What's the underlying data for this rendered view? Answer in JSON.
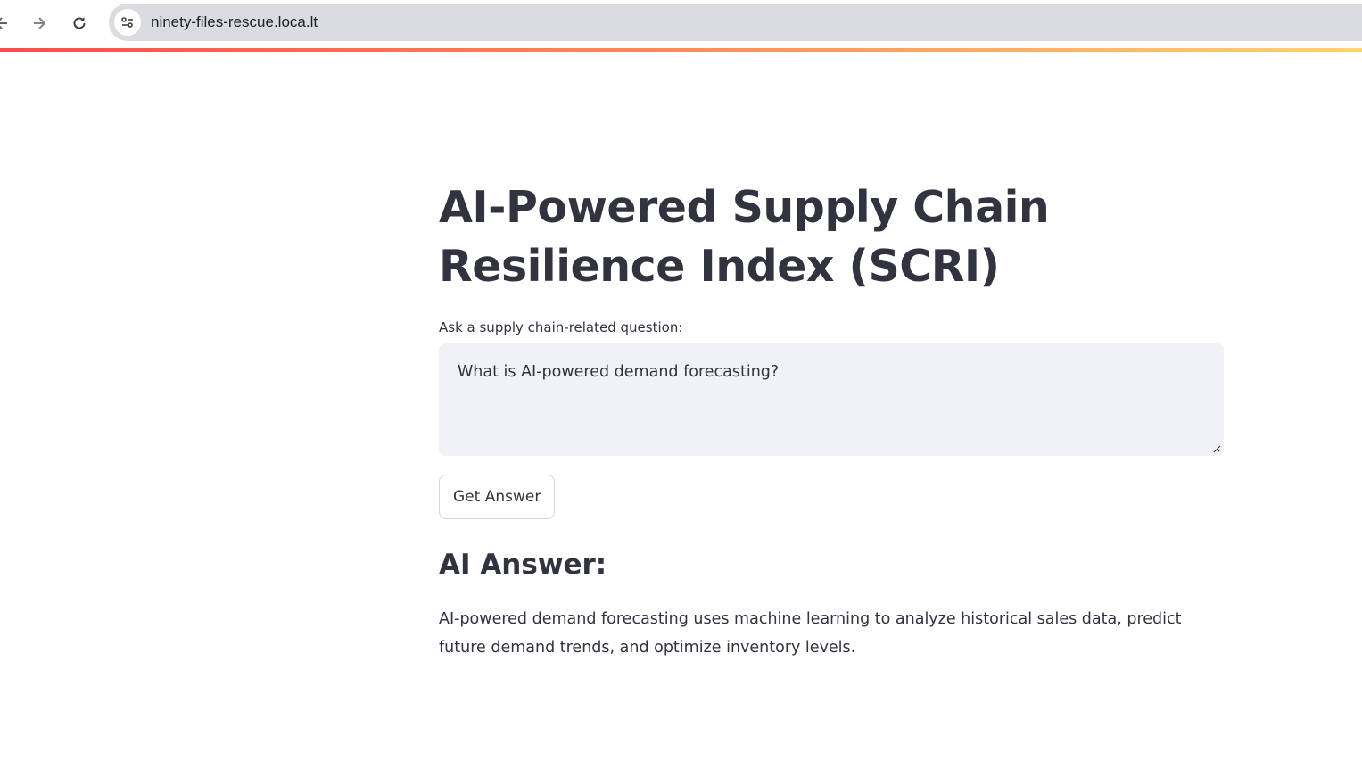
{
  "browser": {
    "url": "ninety-files-rescue.loca.lt",
    "back_icon": "arrow-left-icon",
    "forward_icon": "arrow-right-icon",
    "reload_icon": "reload-icon",
    "site_info_icon": "tune-icon"
  },
  "accent_colors": {
    "progress_gradient": [
      "#ff4b4b",
      "#ff8b5a",
      "#ffd36e"
    ]
  },
  "app": {
    "title": "AI-Powered Supply Chain Resilience Index (SCRI)",
    "question_label": "Ask a supply chain-related question:",
    "question_value": "What is AI-powered demand forecasting?",
    "submit_label": "Get Answer",
    "answer_heading": "AI Answer:",
    "answer_text": "AI-powered demand forecasting uses machine learning to analyze historical sales data, predict future demand trends, and optimize inventory levels."
  }
}
